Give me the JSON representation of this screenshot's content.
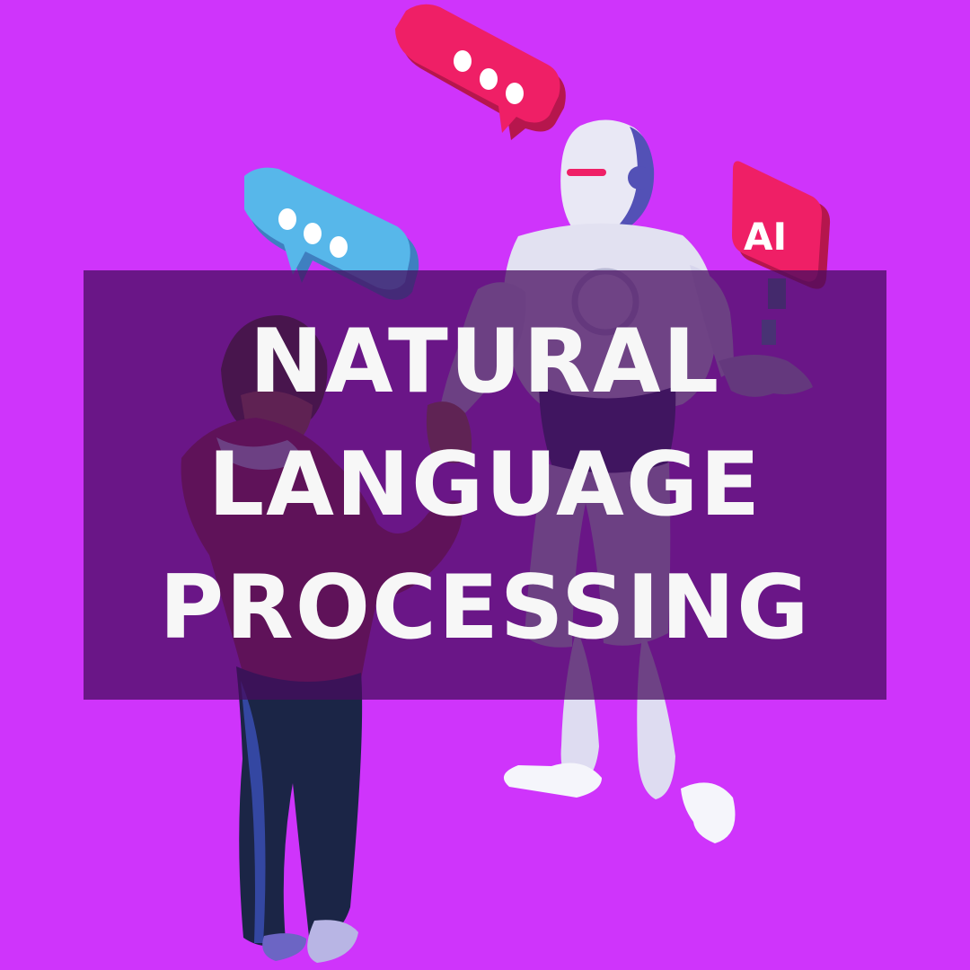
{
  "title": {
    "lines": [
      "NATURAL",
      "LANGUAGE",
      "PROCESSING"
    ]
  },
  "badge": {
    "label": "AI"
  },
  "colors": {
    "background": "#cf34fb",
    "banner": "#460c5f",
    "text": "#f7f7f7",
    "pink_bubble": "#ef1f66",
    "blue_bubble": "#57b7ea",
    "robot_body": "#e9e8f5",
    "robot_accent": "#5351b6",
    "person_sweater": "#a72349",
    "person_pants": "#1b2546"
  },
  "icons": [
    "speech-bubble-icon",
    "ai-badge-icon",
    "handshake-illustration"
  ]
}
